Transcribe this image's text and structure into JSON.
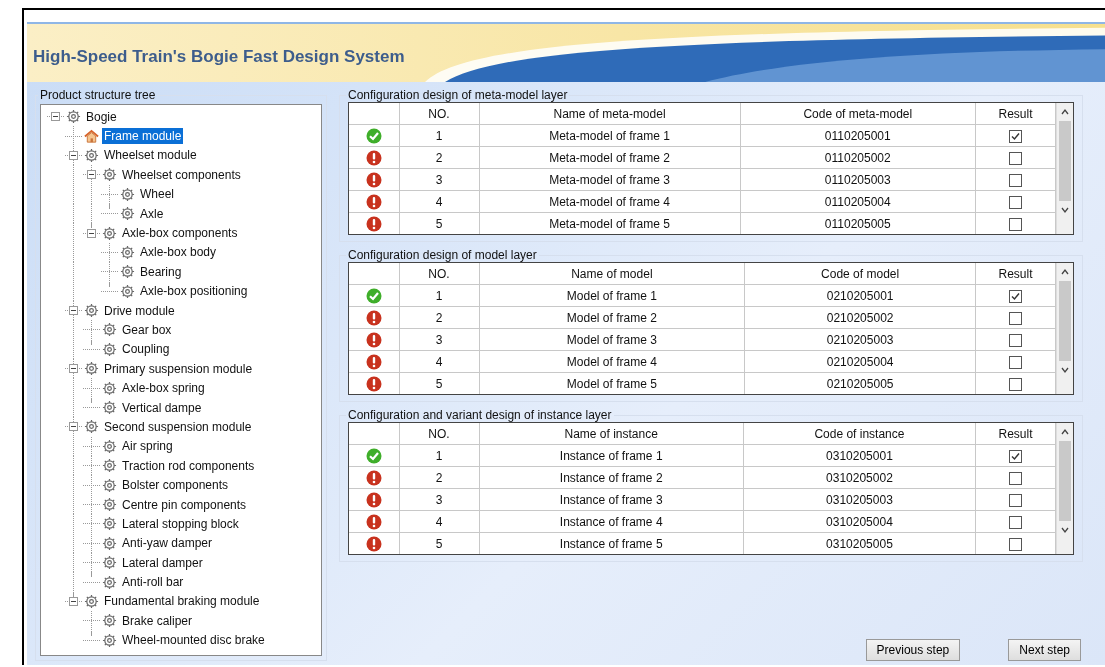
{
  "app": {
    "title": "High-Speed Train's Bogie Fast Design System"
  },
  "tree_panel": {
    "title": "Product structure tree"
  },
  "tree": [
    {
      "label": "Bogie",
      "kind": "gear",
      "selected": false,
      "expanded": true,
      "children": [
        {
          "label": "Frame module",
          "kind": "house",
          "selected": true
        },
        {
          "label": "Wheelset module",
          "kind": "gear",
          "selected": false,
          "expanded": true,
          "children": [
            {
              "label": "Wheelset components",
              "kind": "gear",
              "selected": false,
              "expanded": true,
              "children": [
                {
                  "label": "Wheel",
                  "kind": "gear",
                  "selected": false
                },
                {
                  "label": "Axle",
                  "kind": "gear",
                  "selected": false
                }
              ]
            },
            {
              "label": "Axle-box components",
              "kind": "gear",
              "selected": false,
              "expanded": true,
              "children": [
                {
                  "label": "Axle-box body",
                  "kind": "gear",
                  "selected": false
                },
                {
                  "label": "Bearing",
                  "kind": "gear",
                  "selected": false
                },
                {
                  "label": "Axle-box positioning",
                  "kind": "gear",
                  "selected": false
                }
              ]
            }
          ]
        },
        {
          "label": "Drive module",
          "kind": "gear",
          "selected": false,
          "expanded": true,
          "children": [
            {
              "label": "Gear box",
              "kind": "gear",
              "selected": false
            },
            {
              "label": "Coupling",
              "kind": "gear",
              "selected": false
            }
          ]
        },
        {
          "label": "Primary suspension module",
          "kind": "gear",
          "selected": false,
          "expanded": true,
          "children": [
            {
              "label": "Axle-box spring",
              "kind": "gear",
              "selected": false
            },
            {
              "label": "Vertical dampe",
              "kind": "gear",
              "selected": false
            }
          ]
        },
        {
          "label": "Second suspension module",
          "kind": "gear",
          "selected": false,
          "expanded": true,
          "children": [
            {
              "label": "Air spring",
              "kind": "gear",
              "selected": false
            },
            {
              "label": "Traction rod components",
              "kind": "gear",
              "selected": false
            },
            {
              "label": "Bolster components",
              "kind": "gear",
              "selected": false
            },
            {
              "label": "Centre pin components",
              "kind": "gear",
              "selected": false
            },
            {
              "label": "Lateral stopping block",
              "kind": "gear",
              "selected": false
            },
            {
              "label": "Anti-yaw damper",
              "kind": "gear",
              "selected": false
            },
            {
              "label": "Lateral damper",
              "kind": "gear",
              "selected": false
            },
            {
              "label": "Anti-roll bar",
              "kind": "gear",
              "selected": false
            }
          ]
        },
        {
          "label": "Fundamental braking module",
          "kind": "gear",
          "selected": false,
          "expanded": true,
          "children": [
            {
              "label": "Brake caliper",
              "kind": "gear",
              "selected": false
            },
            {
              "label": "Wheel-mounted disc brake",
              "kind": "gear",
              "selected": false
            }
          ]
        }
      ]
    }
  ],
  "tables": [
    {
      "title": "Configuration design of meta-model layer",
      "columns": [
        "NO.",
        "Name of meta-model",
        "Code of meta-model",
        "Result"
      ],
      "rows": [
        {
          "kind": "ok",
          "no": "1",
          "name": "Meta-model of frame 1",
          "code": "0110205001",
          "checked": true
        },
        {
          "kind": "error",
          "no": "2",
          "name": "Meta-model of frame 2",
          "code": "0110205002",
          "checked": false
        },
        {
          "kind": "error",
          "no": "3",
          "name": "Meta-model of frame 3",
          "code": "0110205003",
          "checked": false
        },
        {
          "kind": "error",
          "no": "4",
          "name": "Meta-model of frame 4",
          "code": "0110205004",
          "checked": false
        },
        {
          "kind": "error",
          "no": "5",
          "name": "Meta-model of frame 5",
          "code": "0110205005",
          "checked": false
        }
      ]
    },
    {
      "title": "Configuration design of model layer",
      "columns": [
        "NO.",
        "Name of model",
        "Code of model",
        "Result"
      ],
      "rows": [
        {
          "kind": "ok",
          "no": "1",
          "name": "Model of frame 1",
          "code": "0210205001",
          "checked": true
        },
        {
          "kind": "error",
          "no": "2",
          "name": "Model of frame 2",
          "code": "0210205002",
          "checked": false
        },
        {
          "kind": "error",
          "no": "3",
          "name": "Model of frame 3",
          "code": "0210205003",
          "checked": false
        },
        {
          "kind": "error",
          "no": "4",
          "name": "Model of frame 4",
          "code": "0210205004",
          "checked": false
        },
        {
          "kind": "error",
          "no": "5",
          "name": "Model of frame 5",
          "code": "0210205005",
          "checked": false
        }
      ]
    },
    {
      "title": "Configuration and variant design of instance layer",
      "columns": [
        "NO.",
        "Name of instance",
        "Code of instance",
        "Result"
      ],
      "rows": [
        {
          "kind": "ok",
          "no": "1",
          "name": "Instance of frame 1",
          "code": "0310205001",
          "checked": true
        },
        {
          "kind": "error",
          "no": "2",
          "name": "Instance of frame 2",
          "code": "0310205002",
          "checked": false
        },
        {
          "kind": "error",
          "no": "3",
          "name": "Instance of frame 3",
          "code": "0310205003",
          "checked": false
        },
        {
          "kind": "error",
          "no": "4",
          "name": "Instance of frame 4",
          "code": "0310205004",
          "checked": false
        },
        {
          "kind": "error",
          "no": "5",
          "name": "Instance of frame 5",
          "code": "0310205005",
          "checked": false
        }
      ]
    }
  ],
  "buttons": [
    "Previous step",
    "Next step"
  ]
}
